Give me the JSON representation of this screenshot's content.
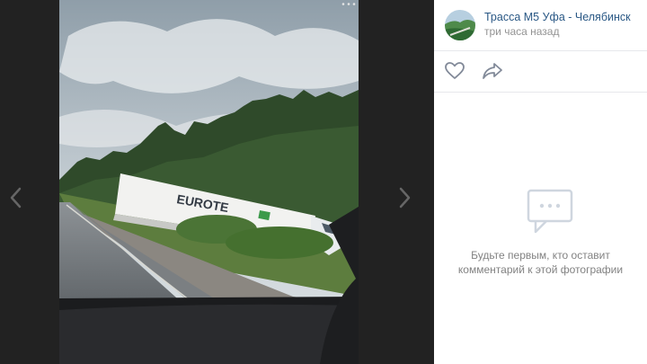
{
  "post": {
    "author": "Трасса М5 Уфа - Челябинск",
    "time": "три часа назад"
  },
  "photo": {
    "truck_text": "EUROTE"
  },
  "comments": {
    "empty_line1": "Будьте первым, кто оставит",
    "empty_line2": "комментарий к этой фотографии"
  },
  "icons": {
    "prev": "chevron-left-icon",
    "next": "chevron-right-icon",
    "like": "heart-icon",
    "share": "share-arrow-icon",
    "comments": "speech-bubble-icon"
  },
  "colors": {
    "link": "#2a5885",
    "muted": "#939393",
    "text_gray": "#828282"
  }
}
